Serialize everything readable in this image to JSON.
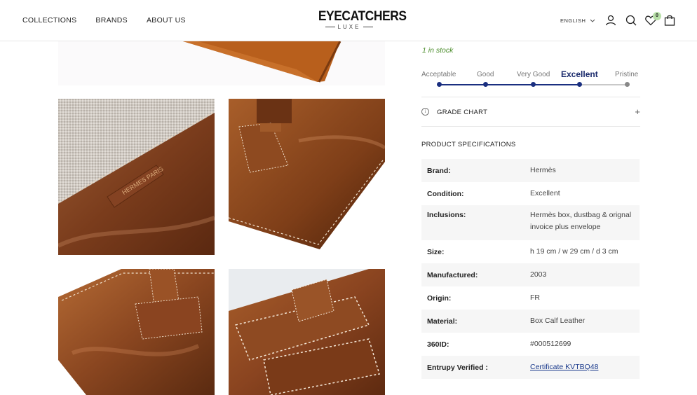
{
  "header": {
    "nav": [
      "COLLECTIONS",
      "BRANDS",
      "ABOUT US"
    ],
    "logo_main": "EYECATCHERS",
    "logo_sub": "LUXE",
    "language": "ENGLISH",
    "wishlist_count": "0"
  },
  "product": {
    "stock": "1 in stock",
    "grades": [
      "Acceptable",
      "Good",
      "Very Good",
      "Excellent",
      "Pristine"
    ],
    "current_grade": "Excellent",
    "grade_chart_label": "GRADE CHART",
    "spec_title": "PRODUCT SPECIFICATIONS",
    "specs": [
      {
        "key": "Brand:",
        "value": "Hermès"
      },
      {
        "key": "Condition:",
        "value": "Excellent"
      },
      {
        "key": "Inclusions:",
        "value": "Hermès box, dustbag & orignal invoice plus envelope"
      },
      {
        "key": "Size:",
        "value": "h 19 cm / w 29 cm / d 3 cm"
      },
      {
        "key": "Manufactured:",
        "value": "2003"
      },
      {
        "key": "Origin:",
        "value": "FR"
      },
      {
        "key": "Material:",
        "value": "Box Calf Leather"
      },
      {
        "key": "360ID:",
        "value": "#000512699"
      },
      {
        "key": "Entrupy Verified :",
        "value": "Certificate KVTBQ48"
      }
    ]
  },
  "gallery": {
    "stamp_text": "HERMES PARIS MADE IN FRANCE"
  },
  "colors": {
    "accent": "#1a2f80",
    "stock_green": "#4a8c2a",
    "leather": "#8a4a22"
  }
}
